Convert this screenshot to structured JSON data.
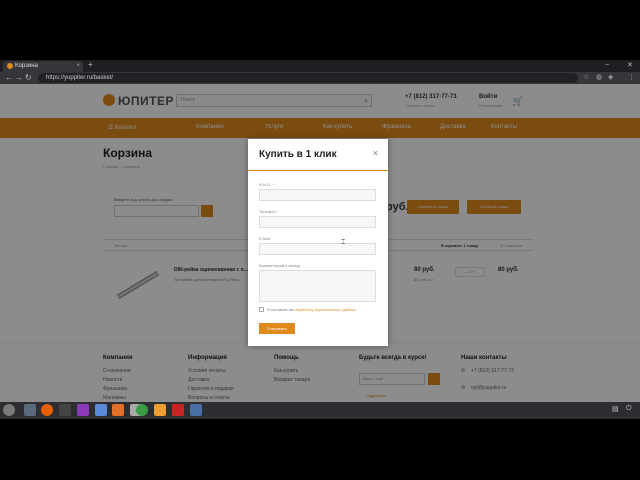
{
  "browser": {
    "tab_title": "Корзина",
    "tab_close": "×",
    "new_tab": "+",
    "url": "https://yuppiter.ru/basket/",
    "back": "←",
    "forward": "→",
    "reload": "↻"
  },
  "header": {
    "logo": "ЮПИТЕР",
    "search_placeholder": "Поиск",
    "phone": "+7 (812) 317-77-73",
    "phone_sub": "Заказать звонок",
    "login": "Войти",
    "login_sub": "Регистрация"
  },
  "menu": [
    "Каталог",
    "Компания",
    "Услуги",
    "Как купить",
    "Франшиза",
    "Доставка",
    "Контакты"
  ],
  "main": {
    "title": "Корзина",
    "breadcrumb": "Главная  —  Корзина",
    "coupon_label": "Введите код купона для скидки:",
    "total_suffix": "руб.",
    "order_button": "Оформить заказ",
    "quick_button": "Быстрый заказ",
    "filter_label": "Фильтр",
    "cart_count": "В корзине: 1 товар",
    "clear_label": "✕ Очистить",
    "product_name": "DIN-рейка оцинкованная с п...",
    "product_sub": "Тип рейки: для монтажа в РЦ Пита...",
    "price": "80 руб.",
    "price_sub": "80 руб./шт",
    "qty": "–  1  +",
    "line_total": "80 руб."
  },
  "footer": {
    "col1_title": "Компания",
    "col1_items": [
      "О компании",
      "Новости",
      "Франшиза",
      "Магазины"
    ],
    "col2_title": "Информация",
    "col2_items": [
      "Условия оплаты",
      "Доставка",
      "Гарантия и подарки",
      "Вопросы и ответы"
    ],
    "col3_title": "Помощь",
    "col3_items": [
      "Как купить",
      "Возврат товара"
    ],
    "col4_title": "Будьте всегда в курсе!",
    "subscribe_placeholder": "Ваш e-mail",
    "subscribe_link": "Подробнее",
    "col5_title": "Наши контакты",
    "col5_phone": "+7 (812) 317-77-73",
    "col5_email": "opt@yuppiter.ru"
  },
  "modal": {
    "title": "Купить в 1 клик",
    "close": "×",
    "field_name": "Ф.И.О.",
    "field_phone": "Телефон",
    "field_email": "E-Mail",
    "field_comment": "Комментарий к заказу",
    "required_mark": "*",
    "agree_text": "Я согласен на",
    "agree_link": "обработку персональных данных",
    "submit": "Отправить"
  },
  "colors": {
    "accent": "#e08a1e"
  }
}
